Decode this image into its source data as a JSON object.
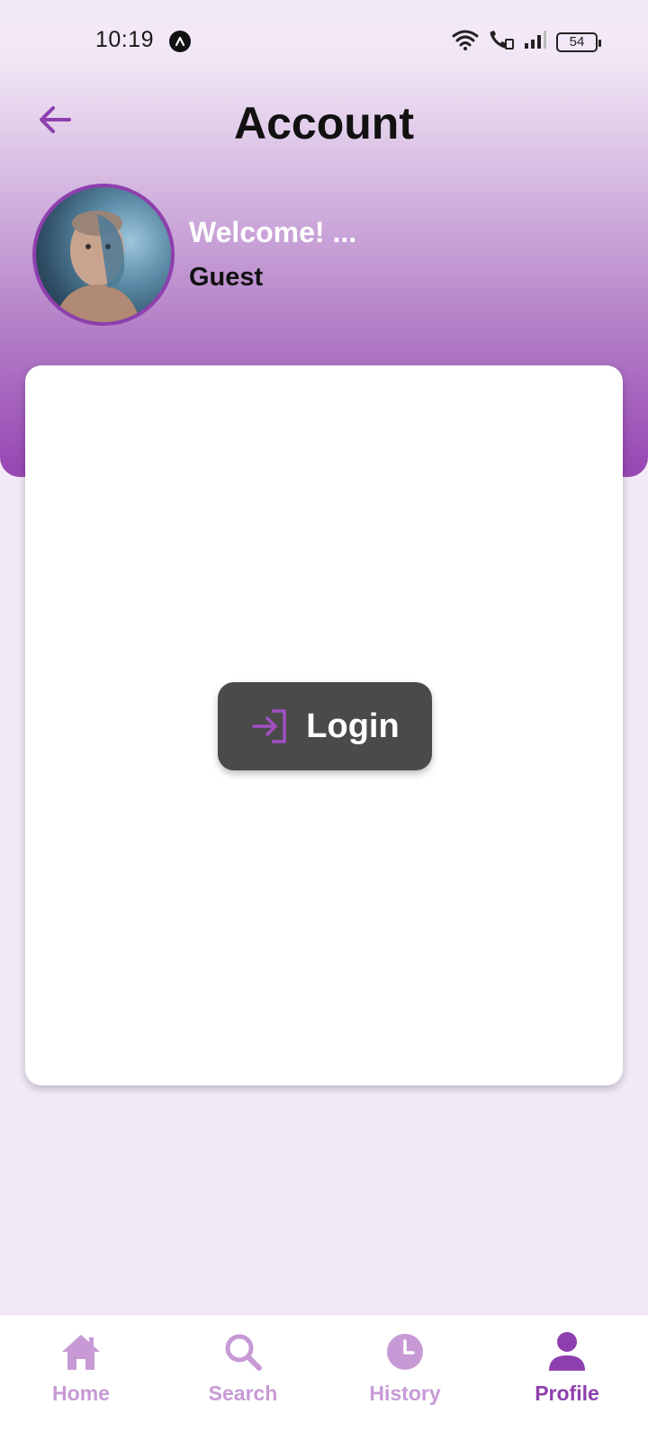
{
  "status_bar": {
    "time": "10:19",
    "battery": "54"
  },
  "header": {
    "title": "Account",
    "back_icon": "arrow-left-icon"
  },
  "profile": {
    "welcome": "Welcome! ...",
    "name": "Guest",
    "avatar_icon": "user-avatar"
  },
  "login": {
    "label": "Login",
    "icon": "login-icon"
  },
  "nav": {
    "items": [
      {
        "label": "Home",
        "icon": "home-icon",
        "active": false
      },
      {
        "label": "Search",
        "icon": "search-icon",
        "active": false
      },
      {
        "label": "History",
        "icon": "clock-icon",
        "active": false
      },
      {
        "label": "Profile",
        "icon": "person-icon",
        "active": true
      }
    ]
  },
  "colors": {
    "accent": "#8e3fae",
    "inactive": "#c79ad6",
    "background": "#f3eaf7",
    "button": "#4a4a4a"
  }
}
